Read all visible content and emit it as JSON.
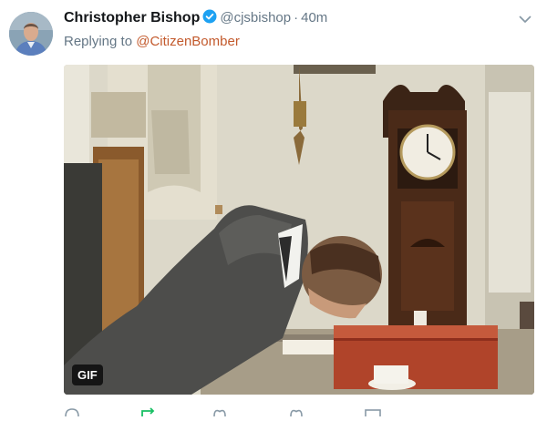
{
  "tweet": {
    "author_name": "Christopher Bishop",
    "handle": "@cjsbishop",
    "separator": "·",
    "time": "40m",
    "reply_prefix": "Replying to",
    "reply_to": "@CitizenBomber",
    "media_badge": "GIF"
  },
  "icons": {
    "verified": "verified-badge-icon",
    "menu": "chevron-down-icon",
    "reply": "reply-icon",
    "retweet": "retweet-icon",
    "like": "heart-icon",
    "dm": "envelope-icon"
  },
  "colors": {
    "link": "#c35a2d",
    "verified": "#1da1f2",
    "secondary_text": "#657786",
    "retweet_active": "#17bf63"
  }
}
